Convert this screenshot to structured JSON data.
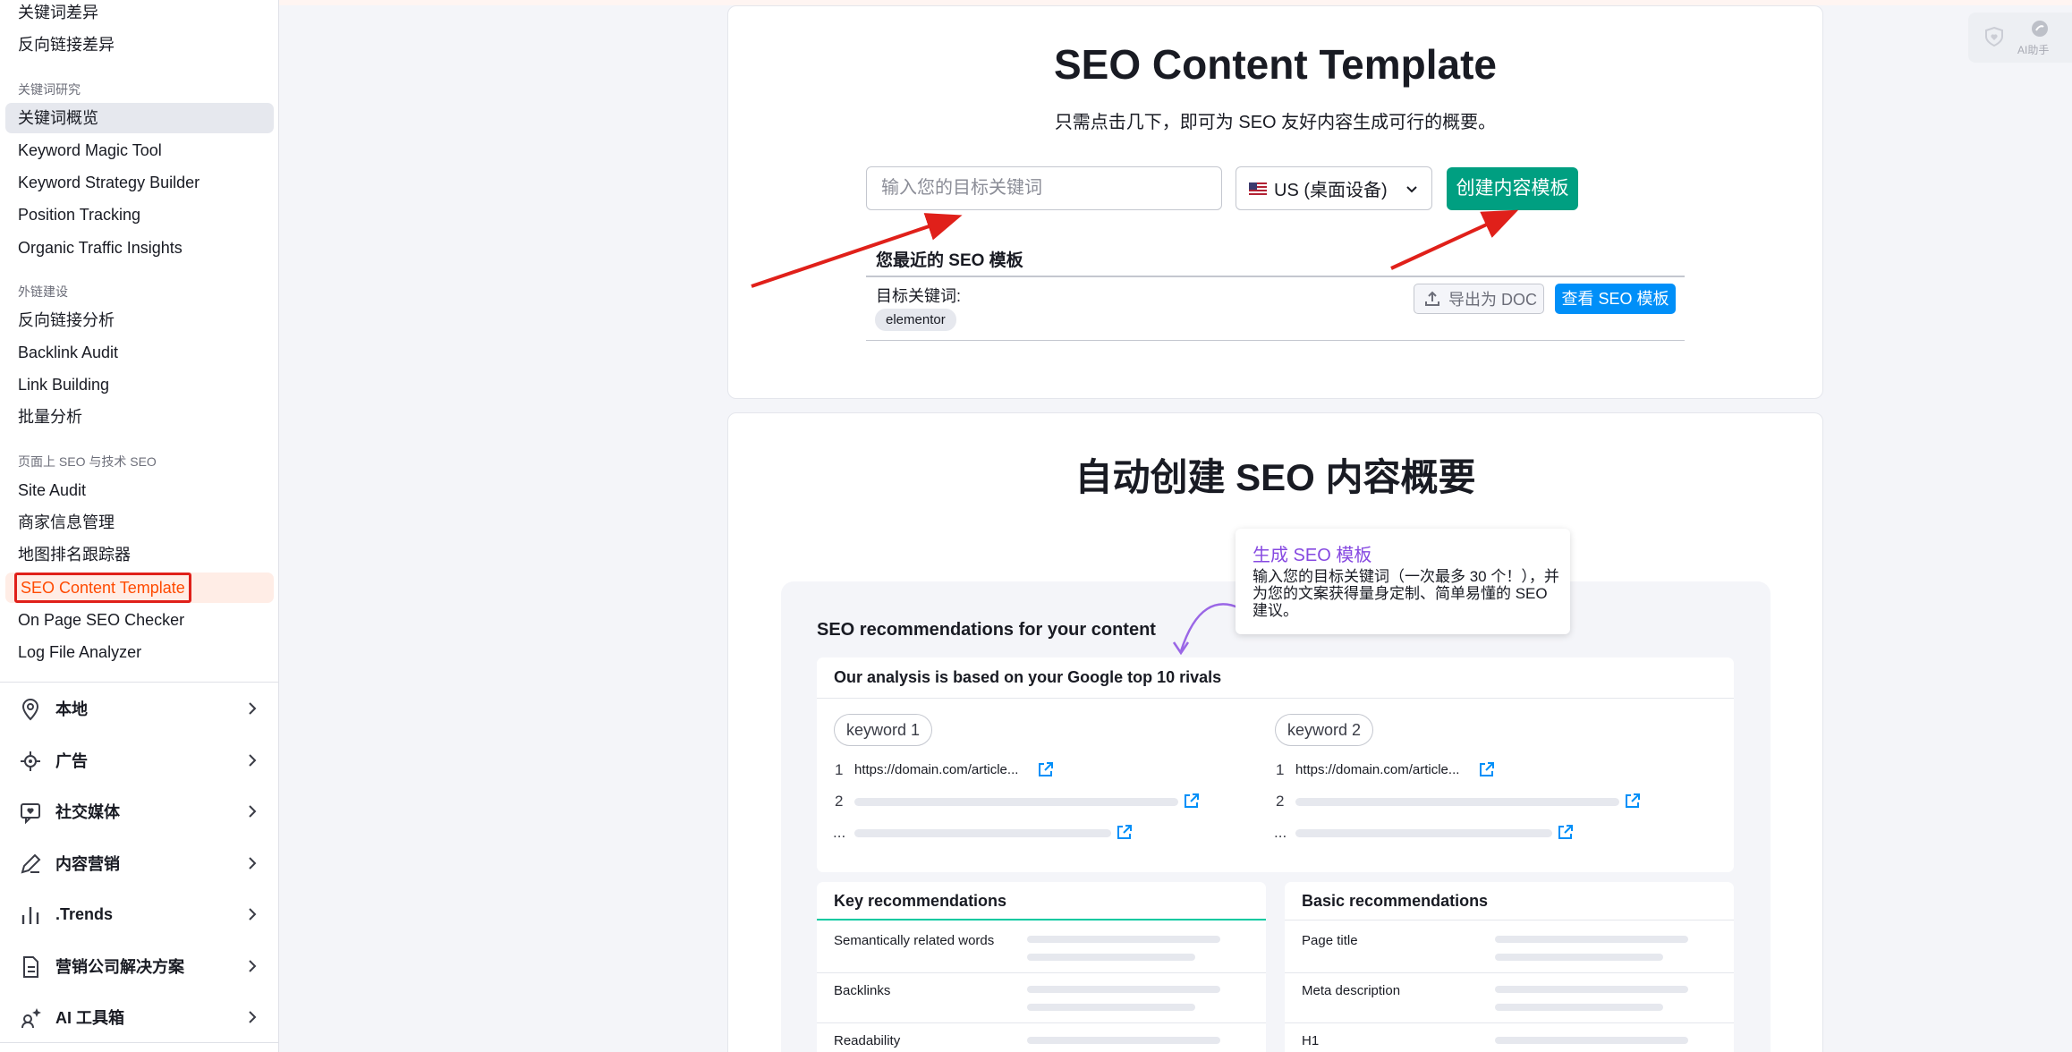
{
  "sidebar": {
    "items_top": [
      "关键词差异",
      "反向链接差异"
    ],
    "section_keyword_research": "关键词研究",
    "keyword_items": [
      "关键词概览",
      "Keyword Magic Tool",
      "Keyword Strategy Builder",
      "Position Tracking",
      "Organic Traffic Insights"
    ],
    "section_link_building": "外链建设",
    "link_items": [
      "反向链接分析",
      "Backlink Audit",
      "Link Building",
      "批量分析"
    ],
    "section_onpage": "页面上 SEO 与技术 SEO",
    "onpage_items": [
      "Site Audit",
      "商家信息管理",
      "地图排名跟踪器",
      "SEO Content Template",
      "On Page SEO Checker",
      "Log File Analyzer"
    ],
    "categories": [
      "本地",
      "广告",
      "社交媒体",
      "内容营销",
      ".Trends",
      "营销公司解决方案",
      "AI 工具箱"
    ]
  },
  "template_card": {
    "title": "SEO Content Template",
    "subtitle": "只需点击几下，即可为 SEO 友好内容生成可行的概要。",
    "keyword_placeholder": "输入您的目标关键词",
    "region": "US (桌面设备)",
    "create_button": "创建内容模板",
    "recent_title": "您最近的 SEO 模板",
    "target_keyword_label": "目标关键词:",
    "keyword_chip": "elementor",
    "export_button": "导出为 DOC",
    "view_button": "查看 SEO 模板"
  },
  "overview_card": {
    "title": "自动创建 SEO 内容概要",
    "tooltip_title": "生成 SEO 模板",
    "tooltip_body": "输入您的目标关键词（一次最多 30 个！），并为您的文案获得量身定制、简单易懂的 SEO 建议。",
    "rec_title": "SEO recommendations for your content",
    "rivals_title": "Our analysis is based on your Google top 10 rivals",
    "keyword1": "keyword 1",
    "keyword2": "keyword 2",
    "row_numbers": [
      "1",
      "2",
      "..."
    ],
    "url": "https://domain.com/article...",
    "key_rec_title": "Key recommendations",
    "key_rec_items": [
      "Semantically related words",
      "Backlinks",
      "Readability"
    ],
    "basic_rec_title": "Basic recommendations",
    "basic_rec_items": [
      "Page title",
      "Meta description",
      "H1"
    ]
  },
  "widget": {
    "label": "AI助手"
  },
  "colors": {
    "accent_green": "#009f81",
    "accent_blue": "#008ff8",
    "highlight_orange": "#ff4a00",
    "annotation_red": "#e0201a",
    "tooltip_purple": "#8649e1"
  }
}
